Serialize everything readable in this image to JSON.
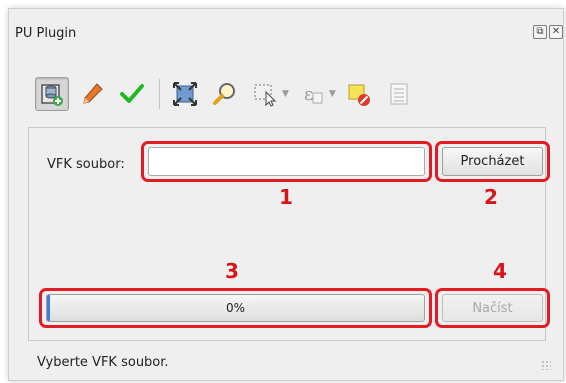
{
  "window": {
    "title": "PU Plugin",
    "float_icon": "float-icon",
    "close_icon": "close-icon"
  },
  "toolbar": {
    "tools": [
      {
        "name": "load-vfk-icon",
        "active": true
      },
      {
        "name": "edit-pencil-icon",
        "active": false
      },
      {
        "name": "check-icon",
        "active": false
      },
      {
        "name": "zoom-to-selected-icon",
        "active": false
      },
      {
        "name": "search-magnifier-icon",
        "active": false
      },
      {
        "name": "select-tool-icon",
        "active": false,
        "dropdown": true
      },
      {
        "name": "expression-select-icon",
        "active": false,
        "dropdown": true
      },
      {
        "name": "clear-selection-icon",
        "active": false
      },
      {
        "name": "attribute-table-icon",
        "active": false
      }
    ]
  },
  "form": {
    "vfk_label": "VFK soubor:",
    "vfk_value": "",
    "browse_label": "Procházet",
    "load_label": "Načíst"
  },
  "progress": {
    "value": 0,
    "text": "0%"
  },
  "annotations": [
    "1",
    "2",
    "3",
    "4"
  ],
  "status": {
    "text": "Vyberte VFK soubor."
  },
  "colors": {
    "annotation_red": "#e31b23",
    "progress_blue": "#3d7fd9",
    "check_green": "#22b822"
  }
}
